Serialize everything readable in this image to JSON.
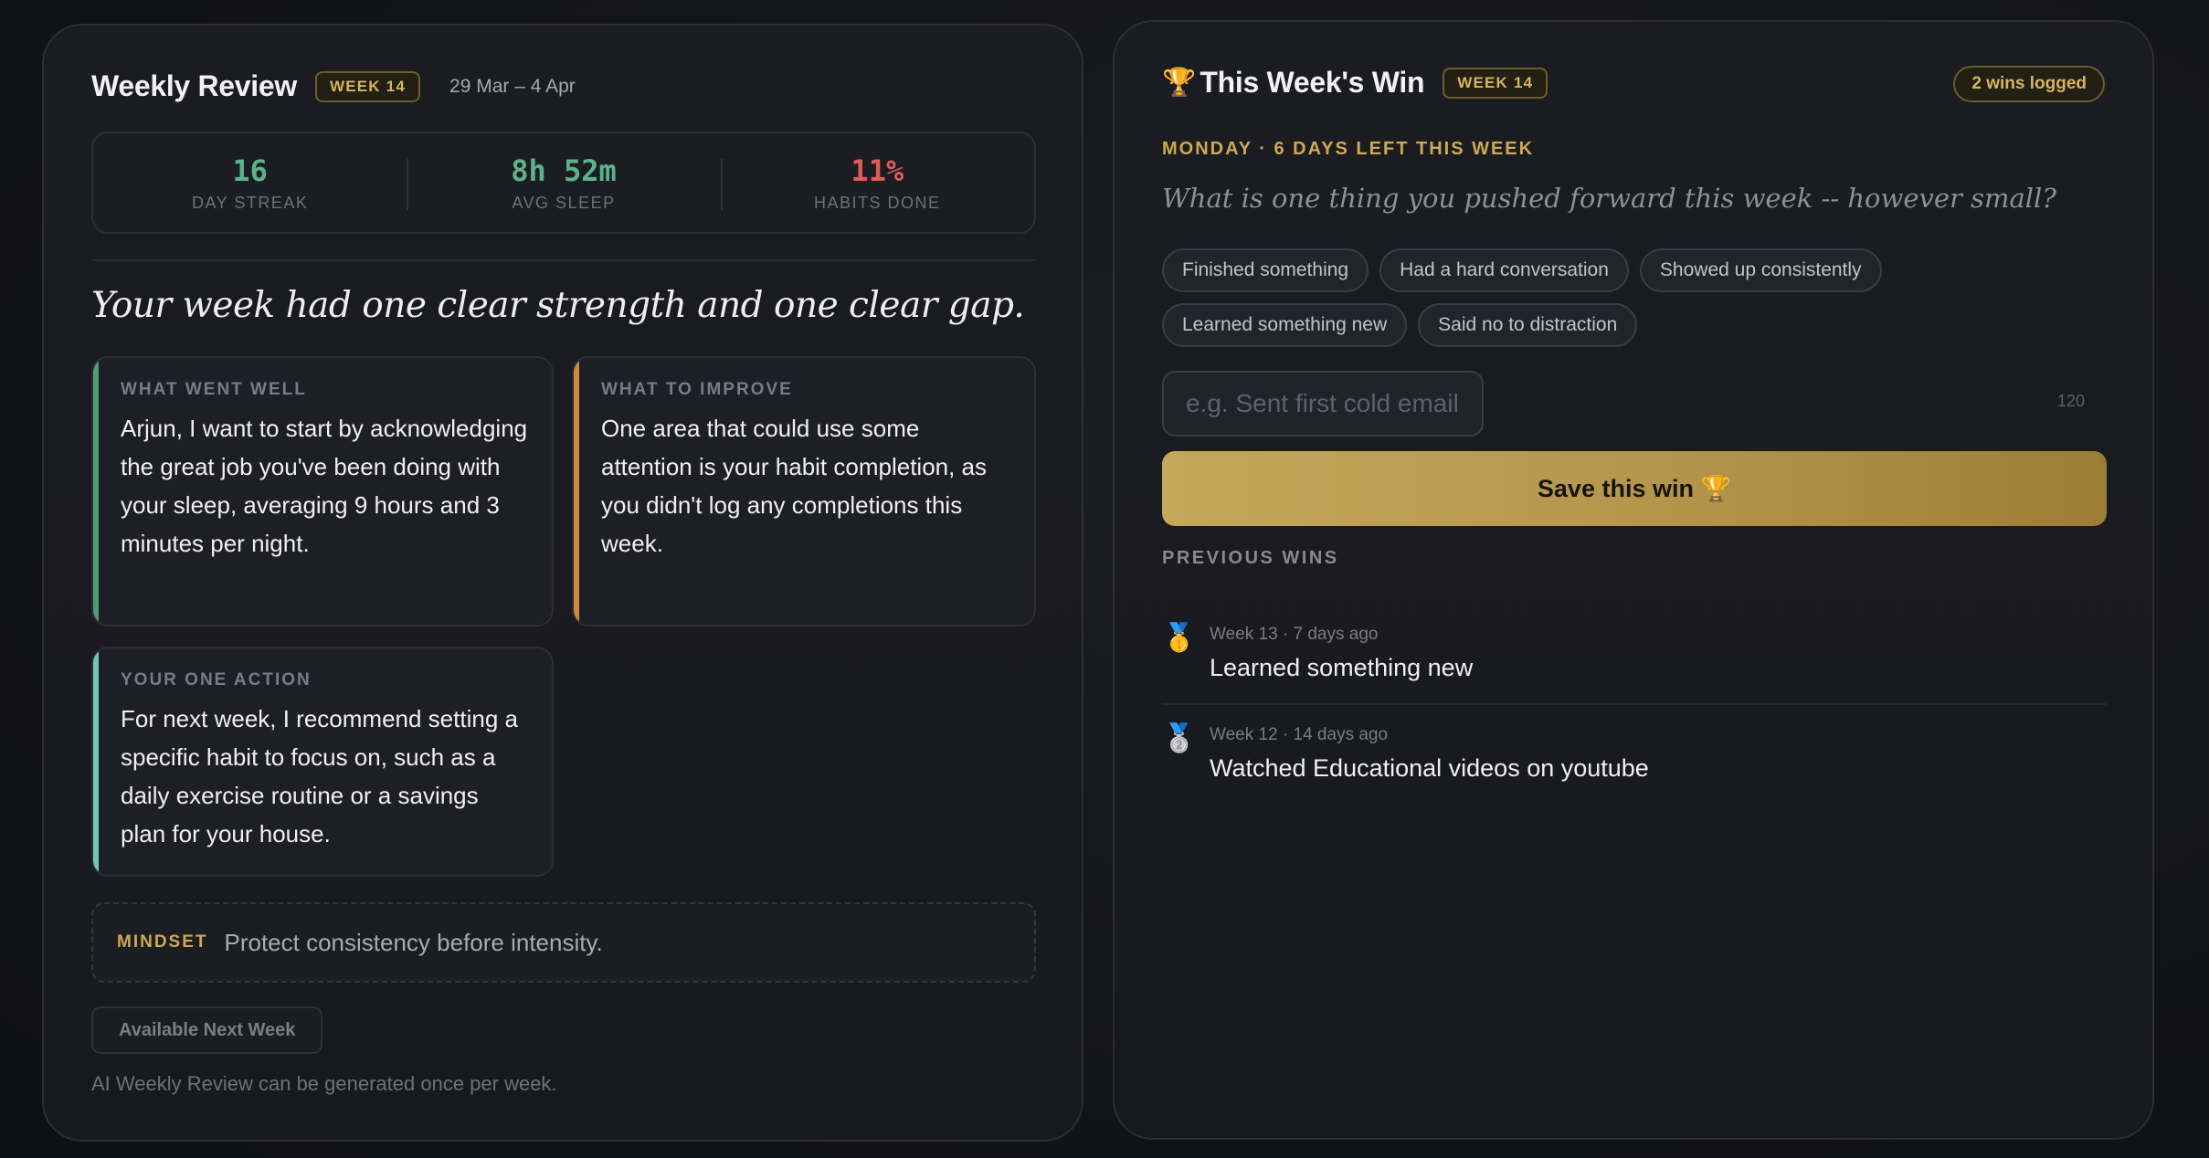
{
  "review": {
    "title": "Weekly Review",
    "week_badge": "WEEK 14",
    "date_range": "29 Mar – 4 Apr",
    "stats": [
      {
        "value": "16",
        "label": "DAY STREAK"
      },
      {
        "value": "8h 52m",
        "label": "AVG SLEEP"
      },
      {
        "value": "11%",
        "label": "HABITS DONE"
      }
    ],
    "headline": "Your week had one clear strength and one clear gap.",
    "went_well": {
      "label": "WHAT WENT WELL",
      "text": "Arjun, I want to start by acknowledging the great job you've been doing with your sleep, averaging 9 hours and 3 minutes per night."
    },
    "improve": {
      "label": "WHAT TO IMPROVE",
      "text": "One area that could use some attention is your habit completion, as you didn't log any completions this week."
    },
    "action": {
      "label": "YOUR ONE ACTION",
      "text": "For next week, I recommend setting a specific habit to focus on, such as a daily exercise routine or a savings plan for your house."
    },
    "mindset": {
      "label": "MINDSET",
      "text": "Protect consistency before intensity."
    },
    "available_button": "Available Next Week",
    "note": "AI Weekly Review can be generated once per week."
  },
  "win": {
    "title": "This Week's Win",
    "trophy_icon": "🏆",
    "week_badge": "WEEK 14",
    "wins_logged": "2 wins logged",
    "dayline": "MONDAY · 6 DAYS LEFT THIS WEEK",
    "prompt": "What is one thing you pushed forward this week -- however small?",
    "chips": [
      "Finished something",
      "Had a hard conversation",
      "Showed up consistently",
      "Learned something new",
      "Said no to distraction"
    ],
    "input_placeholder": "e.g. Sent first cold email",
    "counter": "120",
    "save_label": "Save this win 🏆",
    "previous_label": "PREVIOUS WINS",
    "previous": [
      {
        "medal": "🥇",
        "meta": "Week 13 · 7 days ago",
        "text": "Learned something new"
      },
      {
        "medal": "🥈",
        "meta": "Week 12 · 14 days ago",
        "text": "Watched Educational videos on youtube"
      }
    ]
  },
  "colors": {
    "accent_gold": "#cfa94f",
    "good_green": "#5cb38a",
    "alert_red": "#e05a5a",
    "improve_orange": "#c98a3c",
    "action_teal": "#6fc9b6"
  }
}
